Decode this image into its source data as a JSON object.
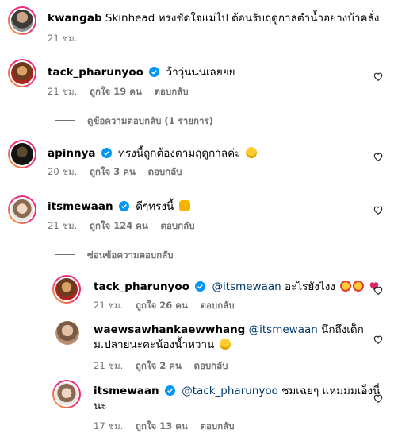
{
  "comments": [
    {
      "user": "kwangab",
      "verified": false,
      "text": "Skinhead ทรงชัดใจแม่ไป ต้อนรับฤดูกาลตำน้ำอย่างบ้าคลั่ง",
      "time": "21 ชม.",
      "likes": "",
      "reply": "",
      "heart": false
    },
    {
      "user": "tack_pharunyoo",
      "verified": true,
      "text": "ว้าวุ่นนนเลยยย",
      "time": "21 ชม.",
      "likes": "ถูกใจ 19 คน",
      "reply": "ตอบกลับ",
      "heart": true
    },
    {
      "user": "apinnya",
      "verified": true,
      "text": "ทรงนี้ถูกต้องตามฤดูกาลค่ะ",
      "time": "20 ชม.",
      "likes": "ถูกใจ 3 คน",
      "reply": "ตอบกลับ",
      "heart": true
    },
    {
      "user": "itsmewaan",
      "verified": true,
      "text": "ดีๆทรงนี้",
      "time": "21 ชม.",
      "likes": "ถูกใจ 124 คน",
      "reply": "ตอบกลับ",
      "heart": true
    }
  ],
  "view_replies": "ดูข้อความตอบกลับ (1 รายการ)",
  "hide_replies": "ซ่อนข้อความตอบกลับ",
  "replies": [
    {
      "user": "tack_pharunyoo",
      "verified": true,
      "mention": "@itsmewaan",
      "text": "อะไรยังไงง",
      "time": "21 ชม.",
      "likes": "ถูกใจ 26 คน",
      "reply": "ตอบกลับ",
      "heart": true
    },
    {
      "user": "waewsawhankaewwhang",
      "verified": false,
      "mention": "@itsmewaan",
      "text": "นึกถึงเด็ก",
      "text2": "ม.ปลายนะคะน้องน้ำหวาน",
      "time": "21 ชม.",
      "likes": "ถูกใจ 2 คน",
      "reply": "ตอบกลับ",
      "heart": true
    },
    {
      "user": "itsmewaan",
      "verified": true,
      "mention": "@tack_pharunyoo",
      "text": "ชมเฉยๆ แหมมมเอ็งนี่",
      "text2": "นะ",
      "time": "17 ชม.",
      "likes": "ถูกใจ 13 คน",
      "reply": "ตอบกลับ",
      "heart": true
    }
  ],
  "icons": {
    "verified": "verified-badge-icon",
    "heart": "heart-outline-icon"
  },
  "colors": {
    "verified": "#0095f6",
    "mention": "#00376b",
    "meta": "#737373"
  }
}
